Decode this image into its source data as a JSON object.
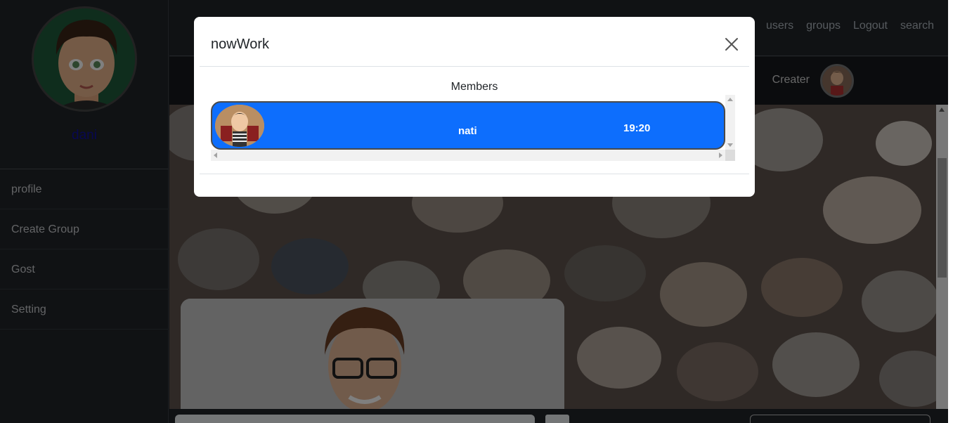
{
  "sidebar": {
    "username": "dani",
    "items": [
      {
        "label": "profile"
      },
      {
        "label": "Create Group"
      },
      {
        "label": "Gost"
      },
      {
        "label": "Setting"
      }
    ]
  },
  "topnav": {
    "links": [
      {
        "label": "users"
      },
      {
        "label": "groups"
      },
      {
        "label": "Logout"
      },
      {
        "label": "search"
      }
    ]
  },
  "header": {
    "creater_label": "Creater"
  },
  "modal": {
    "title": "nowWork",
    "members_label": "Members",
    "members": [
      {
        "name": "nati",
        "time": "19:20"
      }
    ]
  },
  "colors": {
    "accent": "#0d6efd",
    "username": "#1010a0",
    "sidebar_bg": "#212529"
  }
}
